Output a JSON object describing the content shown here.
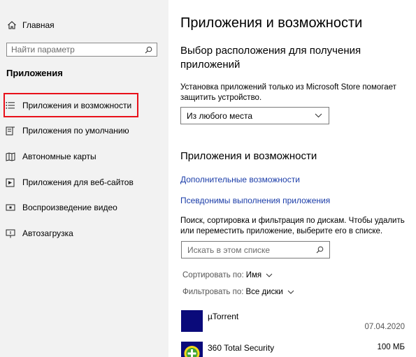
{
  "sidebar": {
    "home_label": "Главная",
    "search_placeholder": "Найти параметр",
    "section_title": "Приложения",
    "items": [
      {
        "label": "Приложения и возможности",
        "icon": "list-icon"
      },
      {
        "label": "Приложения по умолчанию",
        "icon": "default-apps-icon"
      },
      {
        "label": "Автономные карты",
        "icon": "map-icon"
      },
      {
        "label": "Приложения для веб-сайтов",
        "icon": "web-link-icon"
      },
      {
        "label": "Воспроизведение видео",
        "icon": "video-icon"
      },
      {
        "label": "Автозагрузка",
        "icon": "startup-icon"
      }
    ]
  },
  "main": {
    "title": "Приложения и возможности",
    "location_heading": "Выбор расположения для получения приложений",
    "location_desc": "Установка приложений только из Microsoft Store помогает защитить устройство.",
    "location_select": "Из любого места",
    "apps_heading": "Приложения и возможности",
    "link_optional": "Дополнительные возможности",
    "link_aliases": "Псевдонимы выполнения приложения",
    "search_desc": "Поиск, сортировка и фильтрация по дискам. Чтобы удалить или переместить приложение, выберите его в списке.",
    "list_search_placeholder": "Искать в этом списке",
    "sort_label": "Сортировать по:",
    "sort_value": "Имя",
    "filter_label": "Фильтровать по:",
    "filter_value": "Все диски",
    "apps": [
      {
        "name": "µTorrent",
        "size": "",
        "date": "07.04.2020"
      },
      {
        "name": "360 Total Security",
        "size": "100 МБ",
        "date": ""
      }
    ]
  },
  "colors": {
    "sidebar_bg": "#f2f2f2",
    "highlight_border": "#e8101a",
    "link": "#1a3ca8",
    "app_icon_bg": "#0a0a7a"
  }
}
